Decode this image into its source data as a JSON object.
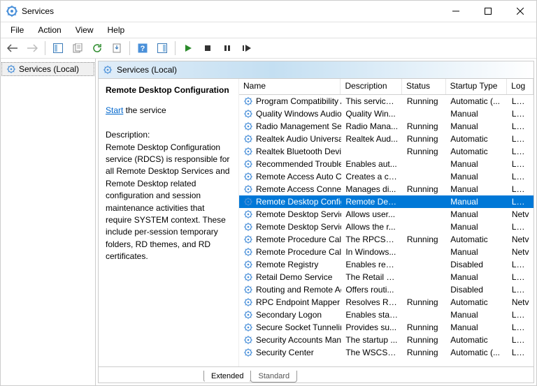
{
  "window": {
    "title": "Services"
  },
  "menu": {
    "file": "File",
    "action": "Action",
    "view": "View",
    "help": "Help"
  },
  "nav": {
    "root": "Services (Local)"
  },
  "content_header": "Services (Local)",
  "detail": {
    "selected_name": "Remote Desktop Configuration",
    "start_link": "Start",
    "start_rest": " the service",
    "desc_label": "Description:",
    "desc_text": "Remote Desktop Configuration service (RDCS) is responsible for all Remote Desktop Services and Remote Desktop related configuration and session maintenance activities that require SYSTEM context. These include per-session temporary folders, RD themes, and RD certificates."
  },
  "columns": {
    "name": "Name",
    "desc": "Description",
    "status": "Status",
    "startup": "Startup Type",
    "logon": "Log"
  },
  "tabs": {
    "extended": "Extended",
    "standard": "Standard"
  },
  "services": [
    {
      "n": "Program Compatibility Assi...",
      "d": "This service ...",
      "s": "Running",
      "t": "Automatic (...",
      "l": "Loca"
    },
    {
      "n": "Quality Windows Audio Vid...",
      "d": "Quality Win...",
      "s": "",
      "t": "Manual",
      "l": "Loca"
    },
    {
      "n": "Radio Management Service",
      "d": "Radio Mana...",
      "s": "Running",
      "t": "Manual",
      "l": "Loca"
    },
    {
      "n": "Realtek Audio Universal Ser...",
      "d": "Realtek Aud...",
      "s": "Running",
      "t": "Automatic",
      "l": "Loca"
    },
    {
      "n": "Realtek Bluetooth Device M...",
      "d": "",
      "s": "Running",
      "t": "Automatic",
      "l": "Loca"
    },
    {
      "n": "Recommended Troublesho...",
      "d": "Enables aut...",
      "s": "",
      "t": "Manual",
      "l": "Loca"
    },
    {
      "n": "Remote Access Auto Conne...",
      "d": "Creates a co...",
      "s": "",
      "t": "Manual",
      "l": "Loca"
    },
    {
      "n": "Remote Access Connection...",
      "d": "Manages di...",
      "s": "Running",
      "t": "Manual",
      "l": "Loca"
    },
    {
      "n": "Remote Desktop Configurat...",
      "d": "Remote Des...",
      "s": "",
      "t": "Manual",
      "l": "Loca",
      "sel": true
    },
    {
      "n": "Remote Desktop Services",
      "d": "Allows user...",
      "s": "",
      "t": "Manual",
      "l": "Netv"
    },
    {
      "n": "Remote Desktop Services U...",
      "d": "Allows the r...",
      "s": "",
      "t": "Manual",
      "l": "Loca"
    },
    {
      "n": "Remote Procedure Call (RPC)",
      "d": "The RPCSS s...",
      "s": "Running",
      "t": "Automatic",
      "l": "Netv"
    },
    {
      "n": "Remote Procedure Call (RP...",
      "d": "In Windows...",
      "s": "",
      "t": "Manual",
      "l": "Netv"
    },
    {
      "n": "Remote Registry",
      "d": "Enables rem...",
      "s": "",
      "t": "Disabled",
      "l": "Loca"
    },
    {
      "n": "Retail Demo Service",
      "d": "The Retail D...",
      "s": "",
      "t": "Manual",
      "l": "Loca"
    },
    {
      "n": "Routing and Remote Access",
      "d": "Offers routi...",
      "s": "",
      "t": "Disabled",
      "l": "Loca"
    },
    {
      "n": "RPC Endpoint Mapper",
      "d": "Resolves RP...",
      "s": "Running",
      "t": "Automatic",
      "l": "Netv"
    },
    {
      "n": "Secondary Logon",
      "d": "Enables star...",
      "s": "",
      "t": "Manual",
      "l": "Loca"
    },
    {
      "n": "Secure Socket Tunneling Pr...",
      "d": "Provides su...",
      "s": "Running",
      "t": "Manual",
      "l": "Loca"
    },
    {
      "n": "Security Accounts Manager",
      "d": "The startup ...",
      "s": "Running",
      "t": "Automatic",
      "l": "Loca"
    },
    {
      "n": "Security Center",
      "d": "The WSCSV...",
      "s": "Running",
      "t": "Automatic (...",
      "l": "Loca"
    }
  ]
}
